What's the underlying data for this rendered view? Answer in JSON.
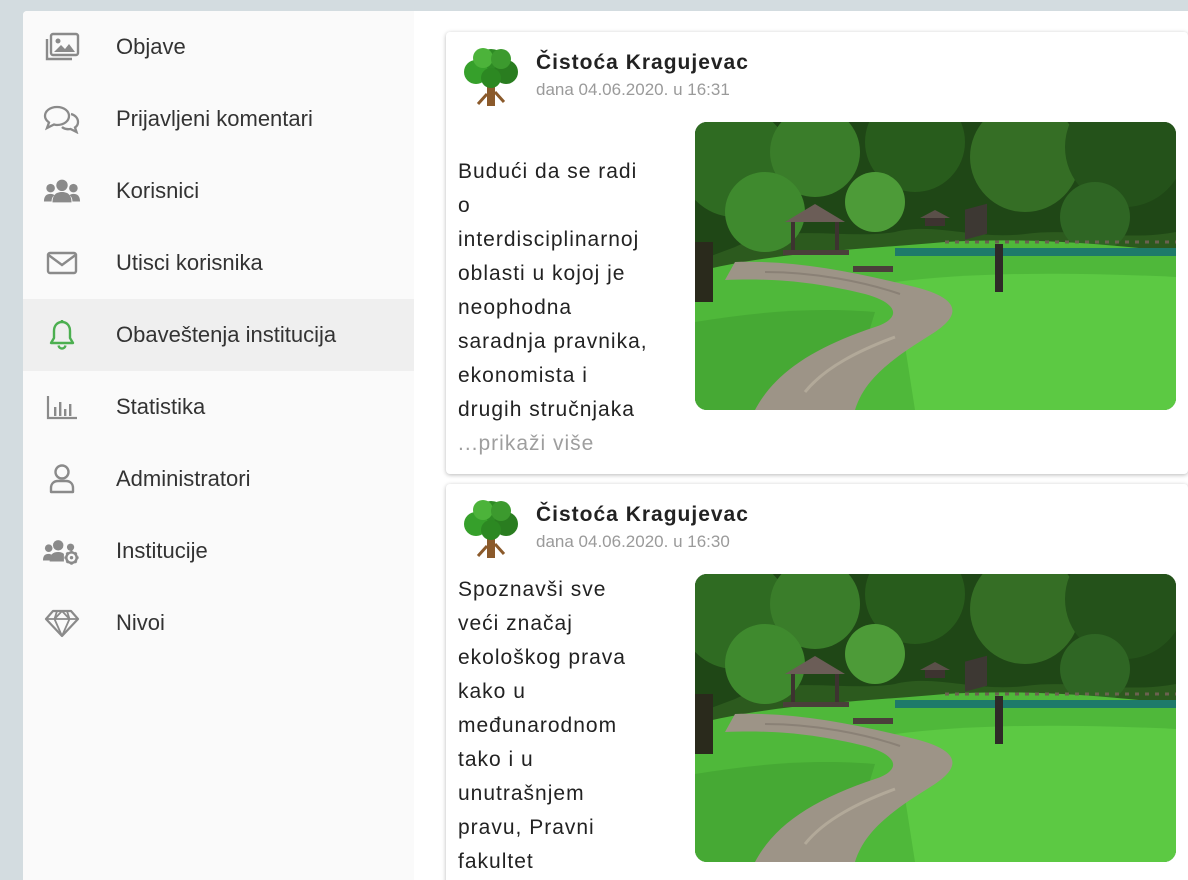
{
  "sidebar": {
    "items": [
      {
        "label": "Objave",
        "icon": "images-icon"
      },
      {
        "label": "Prijavljeni komentari",
        "icon": "comments-icon"
      },
      {
        "label": "Korisnici",
        "icon": "users-icon"
      },
      {
        "label": "Utisci korisnika",
        "icon": "envelope-icon"
      },
      {
        "label": "Obaveštenja institucija",
        "icon": "bell-icon"
      },
      {
        "label": "Statistika",
        "icon": "bar-chart-icon"
      },
      {
        "label": "Administratori",
        "icon": "user-icon"
      },
      {
        "label": "Institucije",
        "icon": "users-cog-icon"
      },
      {
        "label": "Nivoi",
        "icon": "gem-icon"
      }
    ],
    "active_index": 4
  },
  "colors": {
    "accent": "#4caf50",
    "icon_gray": "#8a8a8a",
    "muted_text": "#9a9a9a"
  },
  "posts": [
    {
      "author": "Čistoća Kragujevac",
      "date": "dana 04.06.2020. u 16:31",
      "lines": [
        "Budući da se radi",
        "o",
        "interdisciplinarnoj",
        "oblasti u kojoj je",
        "neophodna",
        "saradnja pravnika,",
        "ekonomista i",
        "drugih stručnjaka"
      ],
      "more": "...prikaži više",
      "image": "park-path-photo"
    },
    {
      "author": "Čistoća Kragujevac",
      "date": "dana 04.06.2020. u 16:30",
      "lines": [
        "Spoznavši sve",
        "veći značaj",
        "ekološkog prava",
        "kako u",
        "međunarodnom",
        "tako i u",
        "unutrašnjem",
        "pravu, Pravni",
        "fakultet"
      ],
      "image": "park-path-photo"
    }
  ]
}
